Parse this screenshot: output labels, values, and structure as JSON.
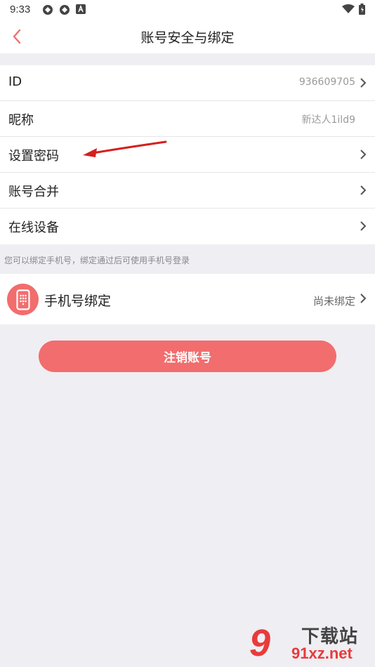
{
  "status_bar": {
    "time": "9:33"
  },
  "navbar": {
    "title": "账号安全与绑定"
  },
  "rows": [
    {
      "label": "ID",
      "value": "936609705",
      "has_arrow": true
    },
    {
      "label": "昵称",
      "value": "新达人1ild9",
      "has_arrow": false
    },
    {
      "label": "设置密码",
      "value": "",
      "has_arrow": true
    },
    {
      "label": "账号合并",
      "value": "",
      "has_arrow": true
    },
    {
      "label": "在线设备",
      "value": "",
      "has_arrow": true
    }
  ],
  "hint": "您可以绑定手机号，绑定通过后可使用手机号登录",
  "phone_binding": {
    "label": "手机号绑定",
    "status": "尚未绑定"
  },
  "logout_button": "注销账号",
  "watermark": {
    "number": "9",
    "chinese": "下载站",
    "url": "91xz.net"
  },
  "colors": {
    "accent": "#f26d6d",
    "background": "#efeef3",
    "annotation_arrow": "#d61f1f"
  },
  "icons": [
    "back-arrow-icon",
    "chevron-right-icon",
    "phone-icon",
    "wifi-icon",
    "battery-icon"
  ]
}
